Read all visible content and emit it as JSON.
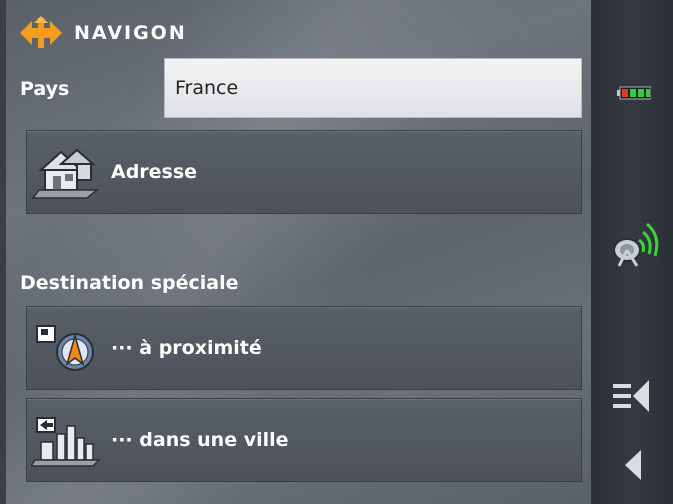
{
  "header": {
    "brand": "NAVIGON"
  },
  "country": {
    "label": "Pays",
    "value": "France"
  },
  "address_button": {
    "label": "Adresse"
  },
  "special_destination": {
    "label": "Destination spéciale"
  },
  "nearby_button": {
    "label": "··· à proximité"
  },
  "in_city_button": {
    "label": "··· dans une ville"
  },
  "colors": {
    "accent": "#f39c1e",
    "battery_green": "#2ecc40",
    "battery_red": "#e03a2a",
    "gps_green": "#3cd33a"
  },
  "side_icons": [
    "battery-icon",
    "gps-satellite-icon",
    "menu-back-icon",
    "back-arrow-icon"
  ]
}
